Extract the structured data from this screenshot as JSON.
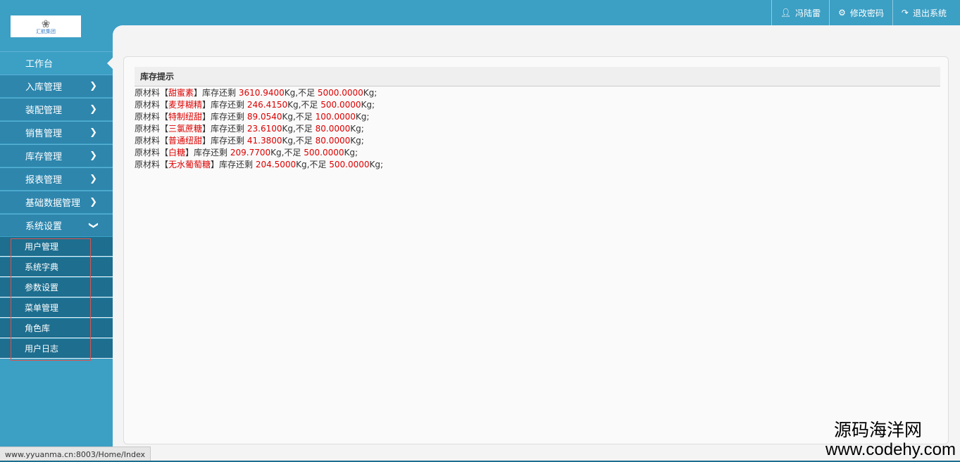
{
  "header": {
    "logo_text": "汇航集团",
    "user_icon": "user-icon",
    "user_name": "冯陆雷",
    "change_password": "修改密码",
    "logout": "退出系统"
  },
  "sidebar": {
    "items": [
      {
        "label": "工作台"
      },
      {
        "label": "入库管理"
      },
      {
        "label": "装配管理"
      },
      {
        "label": "销售管理"
      },
      {
        "label": "库存管理"
      },
      {
        "label": "报表管理"
      },
      {
        "label": "基础数据管理"
      },
      {
        "label": "系统设置"
      }
    ],
    "submenu": [
      {
        "label": "用户管理"
      },
      {
        "label": "系统字典"
      },
      {
        "label": "参数设置"
      },
      {
        "label": "菜单管理"
      },
      {
        "label": "角色库"
      },
      {
        "label": "用户日志"
      }
    ]
  },
  "panel": {
    "title": "库存提示",
    "rows": [
      {
        "prefix": "原材料【",
        "material": "甜蜜素",
        "mid": "】库存还剩 ",
        "remaining": "3610.9400",
        "unit1": "Kg,不足 ",
        "threshold": "5000.0000",
        "unit2": "Kg;"
      },
      {
        "prefix": "原材料【",
        "material": "麦芽糊精",
        "mid": "】库存还剩 ",
        "remaining": "246.4150",
        "unit1": "Kg,不足 ",
        "threshold": "500.0000",
        "unit2": "Kg;"
      },
      {
        "prefix": "原材料【",
        "material": "特制纽甜",
        "mid": "】库存还剩 ",
        "remaining": "89.0540",
        "unit1": "Kg,不足 ",
        "threshold": "100.0000",
        "unit2": "Kg;"
      },
      {
        "prefix": "原材料【",
        "material": "三氯蔗糖",
        "mid": "】库存还剩 ",
        "remaining": "23.6100",
        "unit1": "Kg,不足 ",
        "threshold": "80.0000",
        "unit2": "Kg;"
      },
      {
        "prefix": "原材料【",
        "material": "普通纽甜",
        "mid": "】库存还剩 ",
        "remaining": "41.3800",
        "unit1": "Kg,不足 ",
        "threshold": "80.0000",
        "unit2": "Kg;"
      },
      {
        "prefix": "原材料【",
        "material": "白糖",
        "mid": "】库存还剩 ",
        "remaining": "209.7700",
        "unit1": "Kg,不足 ",
        "threshold": "500.0000",
        "unit2": "Kg;"
      },
      {
        "prefix": "原材料【",
        "material": "无水葡萄糖",
        "mid": "】库存还剩 ",
        "remaining": "204.5000",
        "unit1": "Kg,不足 ",
        "threshold": "500.0000",
        "unit2": "Kg;"
      }
    ]
  },
  "statusbar": {
    "url": "www.yyuanma.cn:8003/Home/Index"
  },
  "watermark": {
    "line1": "源码海洋网",
    "line2": "www.codehy.com"
  },
  "colors": {
    "primary": "#3c9fc4",
    "submenu": "#1d6e8f",
    "alert": "#d00000"
  }
}
